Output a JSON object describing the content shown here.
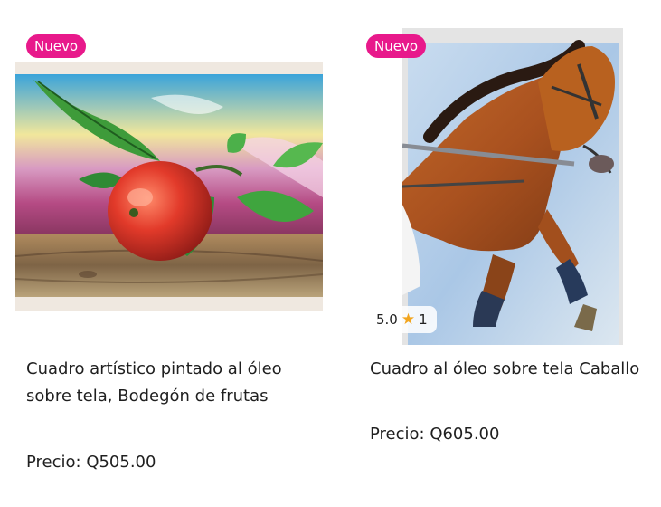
{
  "products": [
    {
      "badge": "Nuevo",
      "title": "Cuadro artístico pintado al óleo sobre tela, Bodegón de frutas",
      "price": "Precio: Q505.00",
      "image": "still-life-apple-painting"
    },
    {
      "badge": "Nuevo",
      "title": "Cuadro al óleo sobre tela Caballo",
      "price": "Precio: Q605.00",
      "image": "horse-painting",
      "rating": {
        "score": "5.0",
        "star": "★",
        "count": "1"
      }
    }
  ],
  "colors": {
    "badge": "#e8198b",
    "star": "#f2a51e",
    "text": "#1f1f1f"
  }
}
